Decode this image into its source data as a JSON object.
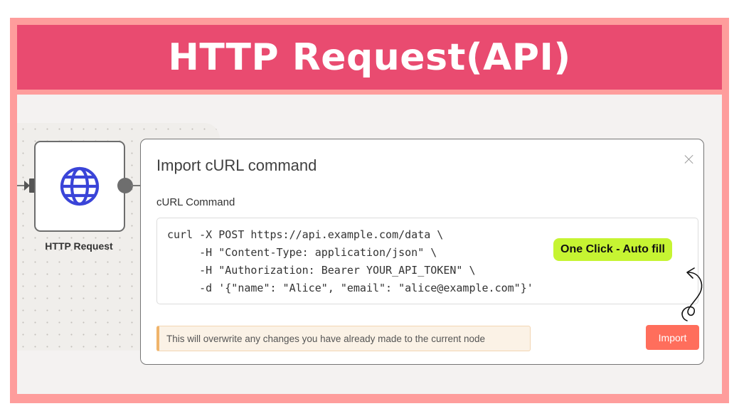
{
  "banner": {
    "title": "HTTP Request(API)"
  },
  "canvas": {
    "node": {
      "label": "HTTP Request",
      "icon": "globe-icon",
      "icon_color": "#3a44d8"
    }
  },
  "modal": {
    "title": "Import cURL command",
    "field_label": "cURL Command",
    "command_lines": [
      "curl -X POST https://api.example.com/data \\",
      "     -H \"Content-Type: application/json\" \\",
      "     -H \"Authorization: Bearer YOUR_API_TOKEN\" \\",
      "     -d '{\"name\": \"Alice\", \"email\": \"alice@example.com\"}'"
    ],
    "warning": "This will overwrite any changes you have already made to the current node",
    "import_label": "Import",
    "close_icon": "close-icon"
  },
  "annotation": {
    "badge": "One Click - Auto fill",
    "arrow_icon": "curly-arrow-icon"
  },
  "colors": {
    "frame": "#fe9d9c",
    "banner": "#e94b70",
    "badge": "#c6f432",
    "import": "#ff6e5c"
  }
}
